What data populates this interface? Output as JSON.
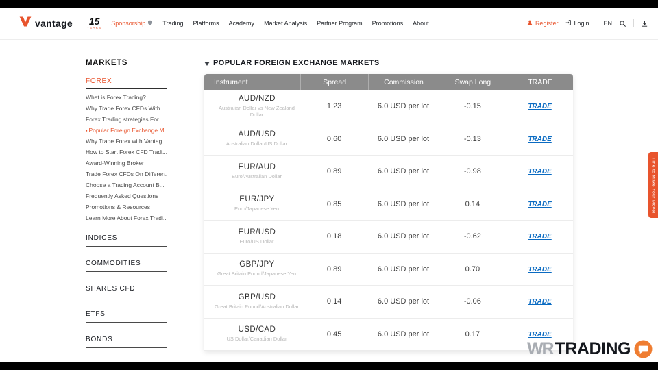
{
  "nav": {
    "logo": "vantage",
    "anniversary": "15",
    "anniversary_sub": "YEARS",
    "items": [
      {
        "label": "Sponsorship"
      },
      {
        "label": "Trading"
      },
      {
        "label": "Platforms"
      },
      {
        "label": "Academy"
      },
      {
        "label": "Market Analysis"
      },
      {
        "label": "Partner Program"
      },
      {
        "label": "Promotions"
      },
      {
        "label": "About"
      }
    ],
    "register": "Register",
    "login": "Login",
    "language": "EN"
  },
  "sidebar": {
    "title": "MARKETS",
    "forex": {
      "label": "FOREX",
      "items": [
        {
          "label": "What is Forex Trading?"
        },
        {
          "label": "Why Trade Forex CFDs With ..."
        },
        {
          "label": "Forex Trading strategies For ..."
        },
        {
          "label": "Popular Foreign Exchange M..."
        },
        {
          "label": "Why Trade Forex with Vantag..."
        },
        {
          "label": "How to Start Forex CFD Tradi..."
        },
        {
          "label": "Award-Winning Broker"
        },
        {
          "label": "Trade Forex CFDs On Differen..."
        },
        {
          "label": "Choose a Trading Account B..."
        },
        {
          "label": "Frequently Asked Questions"
        },
        {
          "label": "Promotions & Resources"
        },
        {
          "label": "Learn More About Forex Tradi..."
        }
      ]
    },
    "sections": [
      {
        "label": "INDICES"
      },
      {
        "label": "COMMODITIES"
      },
      {
        "label": "SHARES CFD"
      },
      {
        "label": "ETFS"
      },
      {
        "label": "BONDS"
      }
    ]
  },
  "main": {
    "title": "POPULAR FOREIGN EXCHANGE MARKETS",
    "table": {
      "headers": [
        "Instrument",
        "Spread",
        "Commission",
        "Swap Long",
        "TRADE"
      ],
      "rows": [
        {
          "instrument": "AUD/NZD",
          "desc": "Australian Dollar vs New Zealand Dollar",
          "spread": "1.23",
          "commission": "6.0 USD per lot",
          "swap": "-0.15",
          "trade_label": "TRADE"
        },
        {
          "instrument": "AUD/USD",
          "desc": "Australian Dollar/US Dollar",
          "spread": "0.60",
          "commission": "6.0 USD per lot",
          "swap": "-0.13",
          "trade_label": "TRADE"
        },
        {
          "instrument": "EUR/AUD",
          "desc": "Euro/Australian Dollar",
          "spread": "0.89",
          "commission": "6.0 USD per lot",
          "swap": "-0.98",
          "trade_label": "TRADE"
        },
        {
          "instrument": "EUR/JPY",
          "desc": "Euro/Japanese Yen",
          "spread": "0.85",
          "commission": "6.0 USD per lot",
          "swap": "0.14",
          "trade_label": "TRADE"
        },
        {
          "instrument": "EUR/USD",
          "desc": "Euro/US Dollar",
          "spread": "0.18",
          "commission": "6.0 USD per lot",
          "swap": "-0.62",
          "trade_label": "TRADE"
        },
        {
          "instrument": "GBP/JPY",
          "desc": "Great Britain Pound/Japanese Yen",
          "spread": "0.89",
          "commission": "6.0 USD per lot",
          "swap": "0.70",
          "trade_label": "TRADE"
        },
        {
          "instrument": "GBP/USD",
          "desc": "Great Britain Pound/Australian Dollar",
          "spread": "0.14",
          "commission": "6.0 USD per lot",
          "swap": "-0.06",
          "trade_label": "TRADE"
        },
        {
          "instrument": "USD/CAD",
          "desc": "US Dollar/Canadian Dollar",
          "spread": "0.45",
          "commission": "6.0 USD per lot",
          "swap": "0.17",
          "trade_label": "TRADE"
        }
      ]
    }
  },
  "ribbon": {
    "label": "Time to Make Your Move!"
  },
  "watermark": {
    "wr": "WR",
    "trading": "TRADING"
  },
  "colors": {
    "accent": "#e8542d",
    "table_header": "#8b8b8b",
    "trade_link": "#0b6bc2"
  }
}
